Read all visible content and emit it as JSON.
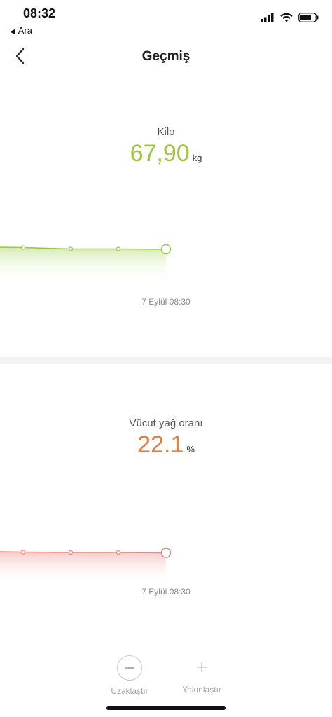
{
  "status": {
    "time": "08:32",
    "back_app": "Ara",
    "icons": [
      "cellular-signal-icon",
      "wifi-icon",
      "battery-icon"
    ]
  },
  "nav": {
    "title": "Geçmiş",
    "back_icon": "chevron-left-icon"
  },
  "metrics": [
    {
      "label": "Kilo",
      "value": "67,90",
      "unit": "kg",
      "color": "#9dc53f",
      "date": "7 Eylül 08:30",
      "chart_data": {
        "type": "line",
        "y": [
          67.9,
          67.92,
          67.89,
          67.9,
          67.9
        ]
      }
    },
    {
      "label": "Vücut yağ oranı",
      "value": "22.1",
      "unit": "%",
      "color": "#e57c40",
      "date": "7 Eylül 08:30",
      "chart_data": {
        "type": "line",
        "y": [
          22.1,
          22.1,
          22.1,
          22.1,
          22.1
        ]
      }
    }
  ],
  "zoom": {
    "zoom_out_label": "Uzaklaştır",
    "zoom_in_label": "Yakınlaştır"
  }
}
